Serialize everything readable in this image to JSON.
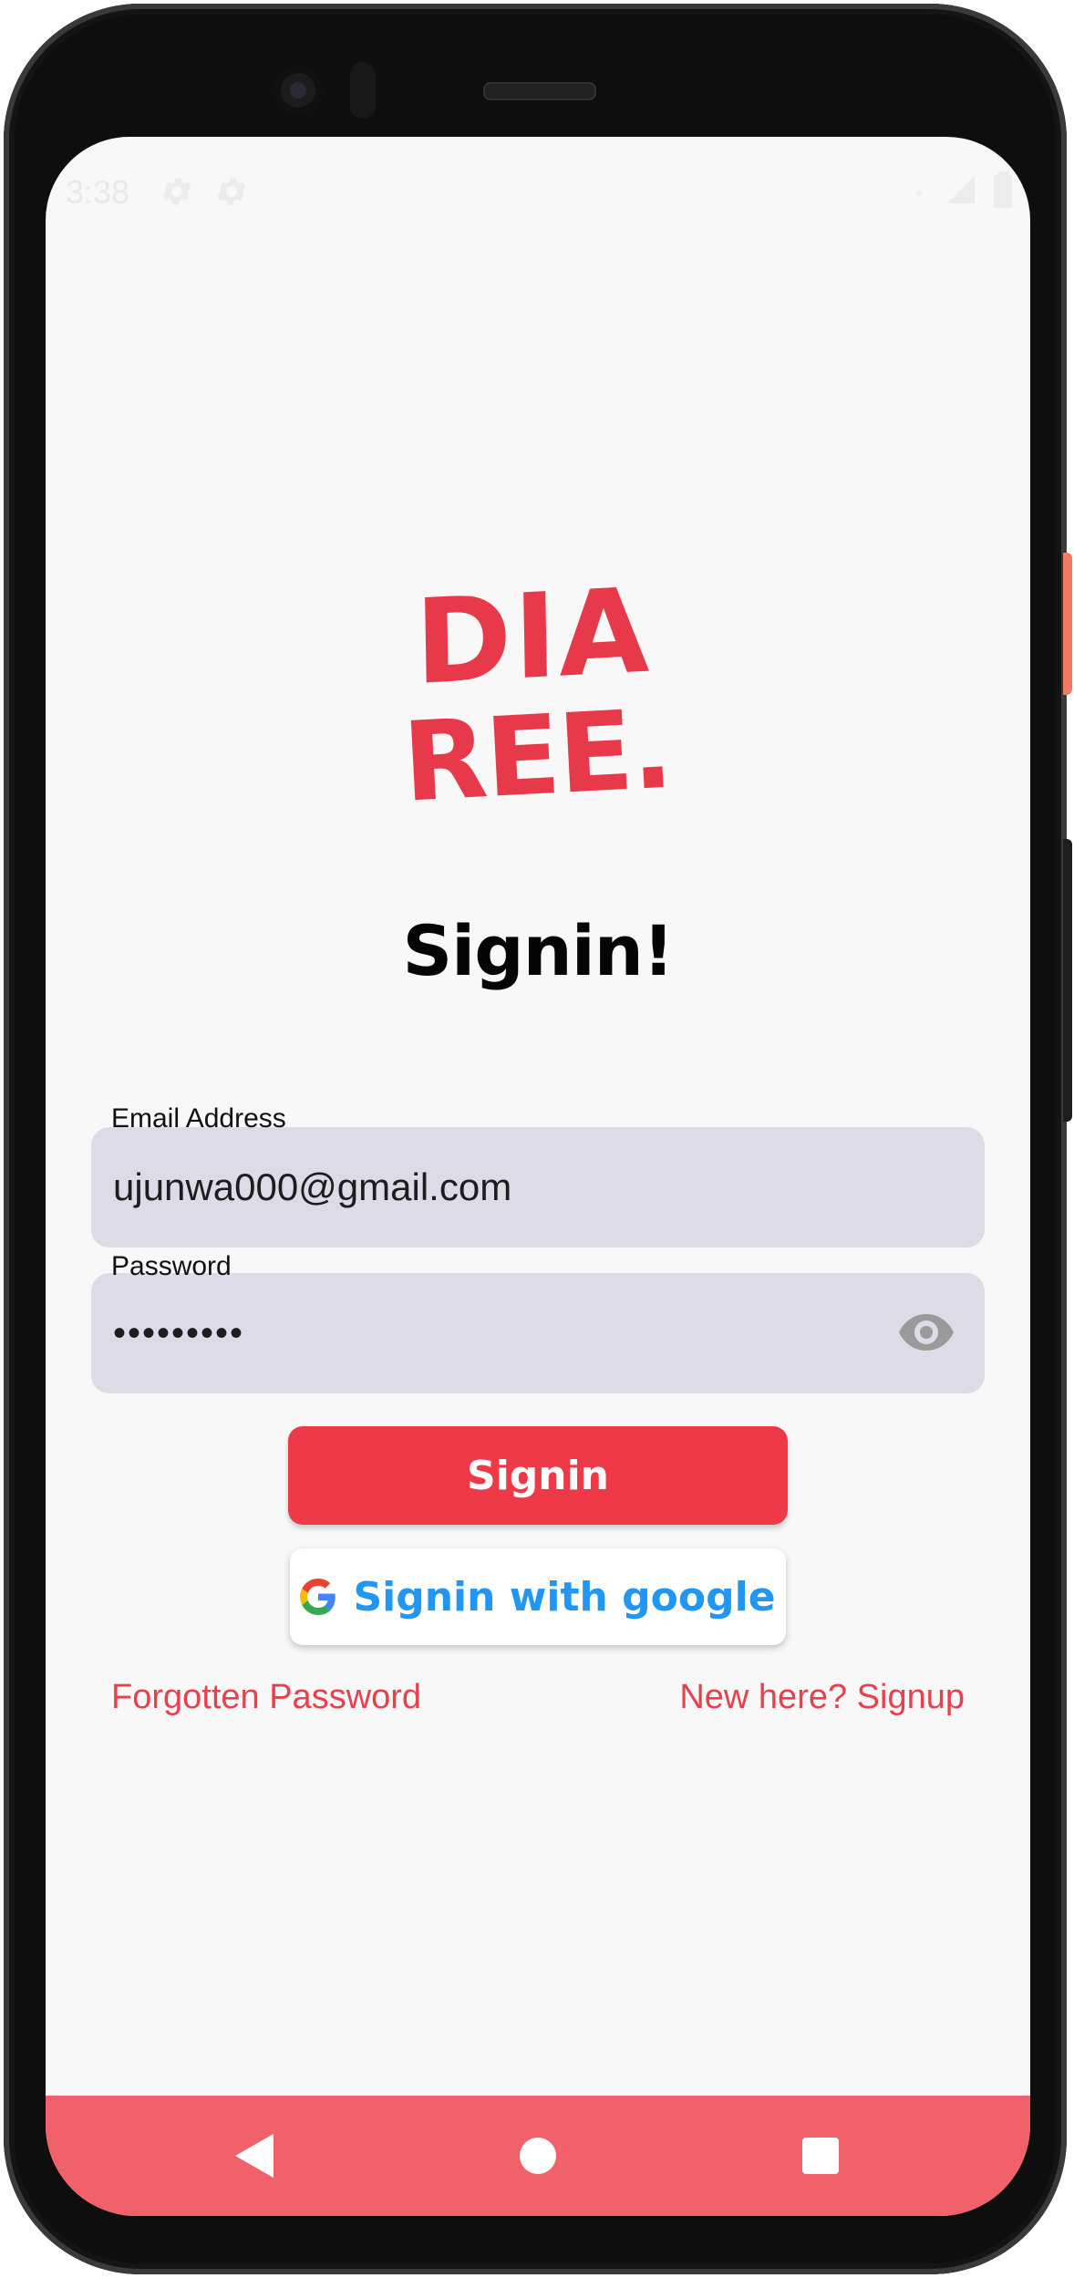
{
  "status_bar": {
    "time": "3:38",
    "icons": [
      "settings-gear-icon",
      "settings-gear-icon",
      "wifi-icon",
      "signal-icon",
      "battery-icon"
    ]
  },
  "logo": {
    "line1": "DIA",
    "line2": "REE.",
    "color": "#e8394a"
  },
  "title": "Signin!",
  "email": {
    "label": "Email Address",
    "value": "ujunwa000@gmail.com"
  },
  "password": {
    "label": "Password",
    "value": "•••••••••",
    "toggle_icon": "eye-icon"
  },
  "buttons": {
    "signin": "Signin",
    "google": "Signin with google"
  },
  "links": {
    "forgot": "Forgotten Password",
    "signup": "New here? Signup"
  },
  "nav": {
    "icons": [
      "back-icon",
      "home-icon",
      "recents-icon"
    ]
  },
  "colors": {
    "primary": "#ee3948",
    "field_bg": "#dddbe6",
    "google_text": "#2196f3",
    "nav_bar": "#f0616a",
    "link": "#e9404e"
  }
}
